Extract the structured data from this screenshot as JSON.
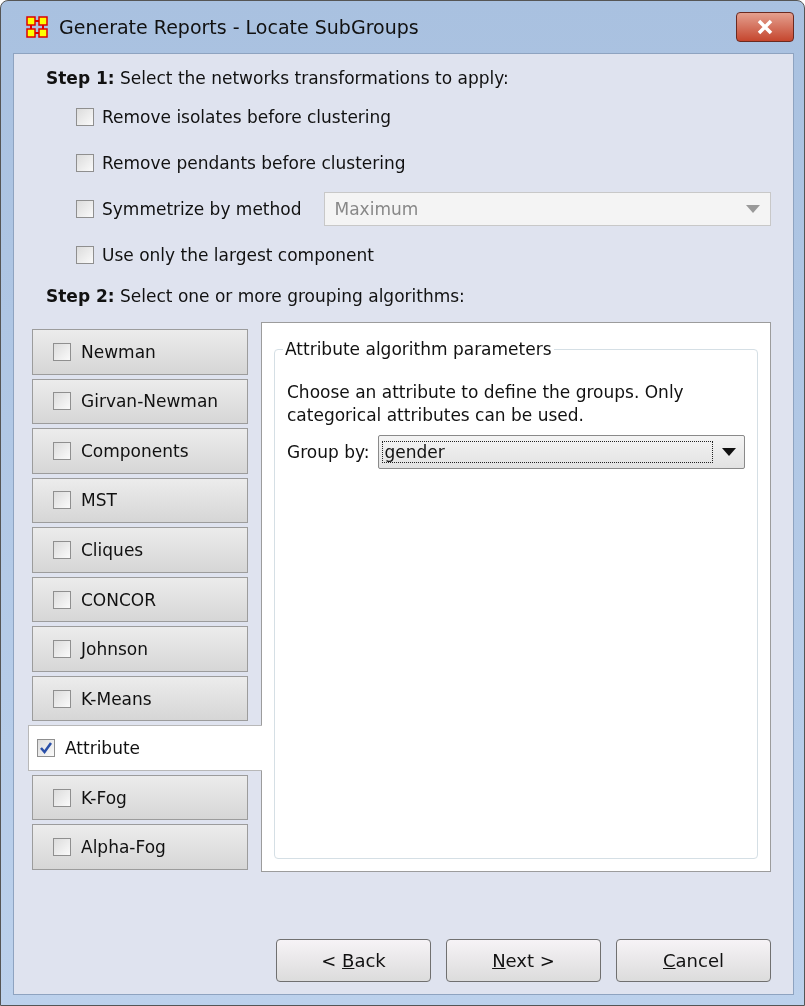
{
  "window": {
    "title": "Generate Reports - Locate SubGroups"
  },
  "step1": {
    "heading": "**Step 1:** Select the networks transformations to apply:",
    "options": [
      {
        "kind": "check",
        "label": "Remove isolates before clustering",
        "checked": false
      },
      {
        "kind": "check",
        "label": "Remove pendants before clustering",
        "checked": false
      },
      {
        "kind": "select",
        "label": "Symmetrize by method",
        "checked": false,
        "value": "Maximum",
        "disabled": true
      },
      {
        "kind": "check",
        "label": "Use only the largest component",
        "checked": false
      }
    ]
  },
  "step2": {
    "heading": "**Step 2:** Select one or more grouping algorithms:",
    "algorithms": [
      {
        "label": "Newman",
        "checked": false,
        "selected": false
      },
      {
        "label": "Girvan-Newman",
        "checked": false,
        "selected": false
      },
      {
        "label": "Components",
        "checked": false,
        "selected": false
      },
      {
        "label": "MST",
        "checked": false,
        "selected": false
      },
      {
        "label": "Cliques",
        "checked": false,
        "selected": false
      },
      {
        "label": "CONCOR",
        "checked": false,
        "selected": false
      },
      {
        "label": "Johnson",
        "checked": false,
        "selected": false
      },
      {
        "label": "K-Means",
        "checked": false,
        "selected": false
      },
      {
        "label": "Attribute",
        "checked": true,
        "selected": true
      },
      {
        "label": "K-Fog",
        "checked": false,
        "selected": false
      },
      {
        "label": "Alpha-Fog",
        "checked": false,
        "selected": false
      }
    ],
    "panel": {
      "title": "Attribute algorithm parameters",
      "description": "Choose an attribute to define the groups. Only categorical attributes can be used.",
      "group_by_label": "Group by:",
      "group_by_value": "gender"
    }
  },
  "buttons": [
    {
      "before": "< ",
      "underlined": "B",
      "after": "ack"
    },
    {
      "underlined": "N",
      "after": "ext >"
    },
    {
      "underlined": "C",
      "after": "ancel"
    }
  ]
}
